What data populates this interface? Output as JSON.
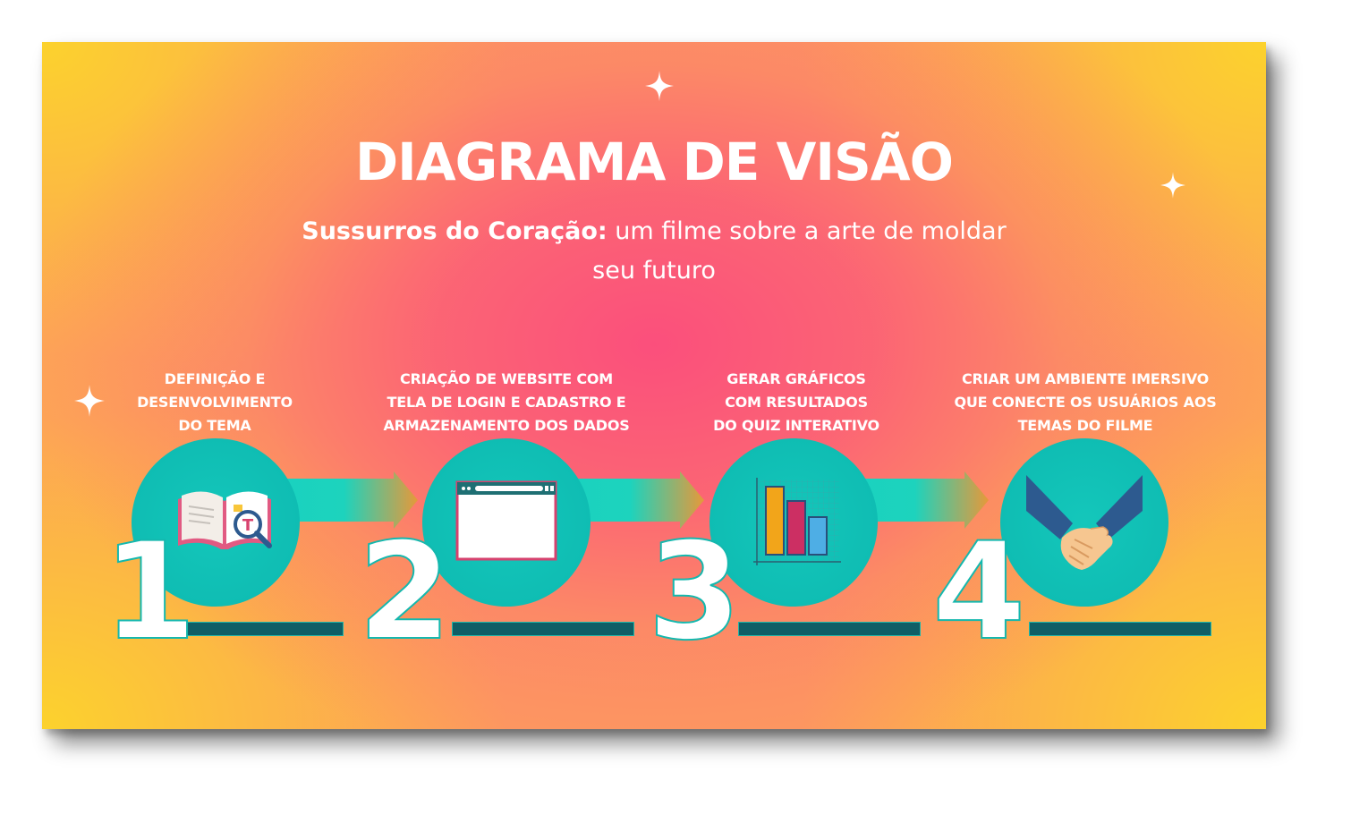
{
  "title": "DIAGRAMA DE VISÃO",
  "subtitle": {
    "bold": "Sussurros do Coração:",
    "rest": " um filme sobre a arte de moldar seu futuro"
  },
  "colors": {
    "accent_teal": "#14c7bb",
    "baseline": "#0f5e66",
    "pink": "#fb4f7c",
    "yellow": "#fcd22d"
  },
  "steps": [
    {
      "number": "1",
      "label": "DEFINIÇÃO E\nDESENVOLVIMENTO\nDO TEMA",
      "icon": "book-search-icon"
    },
    {
      "number": "2",
      "label": "CRIAÇÃO DE WEBSITE COM\nTELA DE LOGIN E CADASTRO E\nARMAZENAMENTO DOS DADOS",
      "icon": "browser-window-icon"
    },
    {
      "number": "3",
      "label": "GERAR GRÁFICOS\nCOM RESULTADOS\nDO QUIZ INTERATIVO",
      "icon": "bar-chart-icon"
    },
    {
      "number": "4",
      "label": "CRIAR UM AMBIENTE IMERSIVO\nQUE CONECTE OS USUÁRIOS AOS\nTEMAS DO FILME",
      "icon": "handshake-icon"
    }
  ]
}
